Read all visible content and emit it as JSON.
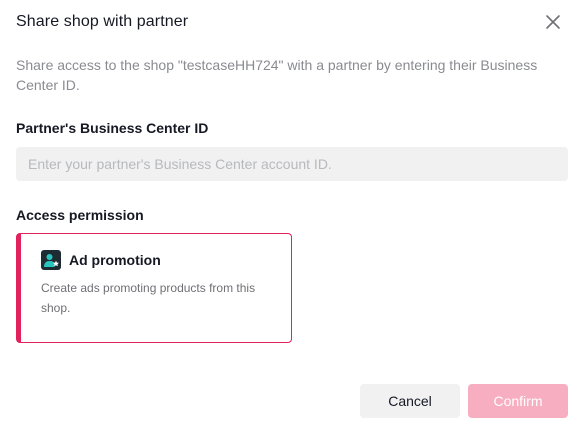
{
  "dialog": {
    "title": "Share shop with partner",
    "description": "Share access to the shop \"testcaseHH724\" with a partner by entering their Business Center ID."
  },
  "partner_id": {
    "label": "Partner's Business Center ID",
    "value": "",
    "placeholder": "Enter your partner's Business Center account ID."
  },
  "permission": {
    "label": "Access permission",
    "card": {
      "title": "Ad promotion",
      "description": "Create ads promoting products from this shop.",
      "icon": "ad-promotion-icon",
      "selected": true
    }
  },
  "actions": {
    "cancel_label": "Cancel",
    "confirm_label": "Confirm"
  },
  "colors": {
    "accent": "#e1225d",
    "confirm_disabled": "#f7aec1",
    "input_bg": "#f1f1f2"
  }
}
